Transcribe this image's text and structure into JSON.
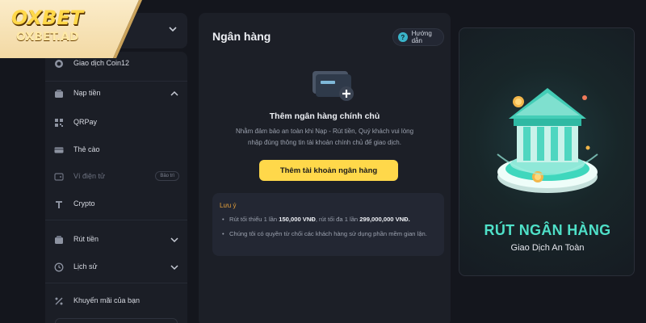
{
  "logo": {
    "line1": "OXBET",
    "line2": "OXBET.AD"
  },
  "sidebar": {
    "items": [
      {
        "label": "Giao dịch Coin12",
        "icon": "coin-icon"
      },
      {
        "label": "Nạp tiền",
        "icon": "wallet-icon",
        "expanded": true
      },
      {
        "label": "QRPay",
        "icon": "qr-icon"
      },
      {
        "label": "Thẻ cào",
        "icon": "card-icon"
      },
      {
        "label": "Ví điện tử",
        "icon": "ewallet-icon",
        "badge": "Bảo trì",
        "disabled": true
      },
      {
        "label": "Crypto",
        "icon": "crypto-icon"
      },
      {
        "label": "Rút tiền",
        "icon": "withdraw-icon"
      },
      {
        "label": "Lịch sử",
        "icon": "history-icon"
      },
      {
        "label": "Khuyến mãi của bạn",
        "icon": "promo-icon"
      }
    ]
  },
  "main": {
    "title": "Ngân hàng",
    "guide_label": "Hướng dẫn",
    "add_title": "Thêm ngân hàng chính chủ",
    "add_desc": "Nhằm đảm bảo an toàn khi Nạp - Rút tiền, Quý khách vui lòng nhập đúng thông tin tài khoản chính chủ để giao dịch.",
    "add_button": "Thêm tài khoản ngân hàng"
  },
  "note": {
    "title": "Lưu ý",
    "line1_a": "Rút tối thiểu 1 lần ",
    "line1_b": "150,000 VNĐ",
    "line1_c": ", rút tối đa 1 lần ",
    "line1_d": "299,000,000 VNĐ.",
    "line2": "Chúng tôi có quyền từ chối các khách hàng sử dụng phần mềm gian lận."
  },
  "promo": {
    "title": "RÚT NGÂN HÀNG",
    "subtitle": "Giao Dịch An Toàn"
  },
  "colors": {
    "accent_yellow": "#ffd84a",
    "accent_teal": "#4fe0c8",
    "note_orange": "#e8a23a",
    "background": "#14161d"
  }
}
